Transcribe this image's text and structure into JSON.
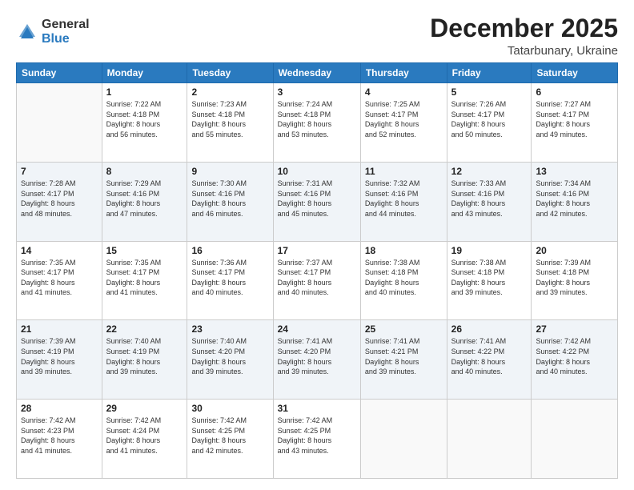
{
  "logo": {
    "general": "General",
    "blue": "Blue"
  },
  "title": "December 2025",
  "location": "Tatarbunary, Ukraine",
  "days_header": [
    "Sunday",
    "Monday",
    "Tuesday",
    "Wednesday",
    "Thursday",
    "Friday",
    "Saturday"
  ],
  "weeks": [
    [
      {
        "day": "",
        "info": ""
      },
      {
        "day": "1",
        "info": "Sunrise: 7:22 AM\nSunset: 4:18 PM\nDaylight: 8 hours\nand 56 minutes."
      },
      {
        "day": "2",
        "info": "Sunrise: 7:23 AM\nSunset: 4:18 PM\nDaylight: 8 hours\nand 55 minutes."
      },
      {
        "day": "3",
        "info": "Sunrise: 7:24 AM\nSunset: 4:18 PM\nDaylight: 8 hours\nand 53 minutes."
      },
      {
        "day": "4",
        "info": "Sunrise: 7:25 AM\nSunset: 4:17 PM\nDaylight: 8 hours\nand 52 minutes."
      },
      {
        "day": "5",
        "info": "Sunrise: 7:26 AM\nSunset: 4:17 PM\nDaylight: 8 hours\nand 50 minutes."
      },
      {
        "day": "6",
        "info": "Sunrise: 7:27 AM\nSunset: 4:17 PM\nDaylight: 8 hours\nand 49 minutes."
      }
    ],
    [
      {
        "day": "7",
        "info": "Sunrise: 7:28 AM\nSunset: 4:17 PM\nDaylight: 8 hours\nand 48 minutes."
      },
      {
        "day": "8",
        "info": "Sunrise: 7:29 AM\nSunset: 4:16 PM\nDaylight: 8 hours\nand 47 minutes."
      },
      {
        "day": "9",
        "info": "Sunrise: 7:30 AM\nSunset: 4:16 PM\nDaylight: 8 hours\nand 46 minutes."
      },
      {
        "day": "10",
        "info": "Sunrise: 7:31 AM\nSunset: 4:16 PM\nDaylight: 8 hours\nand 45 minutes."
      },
      {
        "day": "11",
        "info": "Sunrise: 7:32 AM\nSunset: 4:16 PM\nDaylight: 8 hours\nand 44 minutes."
      },
      {
        "day": "12",
        "info": "Sunrise: 7:33 AM\nSunset: 4:16 PM\nDaylight: 8 hours\nand 43 minutes."
      },
      {
        "day": "13",
        "info": "Sunrise: 7:34 AM\nSunset: 4:16 PM\nDaylight: 8 hours\nand 42 minutes."
      }
    ],
    [
      {
        "day": "14",
        "info": "Sunrise: 7:35 AM\nSunset: 4:17 PM\nDaylight: 8 hours\nand 41 minutes."
      },
      {
        "day": "15",
        "info": "Sunrise: 7:35 AM\nSunset: 4:17 PM\nDaylight: 8 hours\nand 41 minutes."
      },
      {
        "day": "16",
        "info": "Sunrise: 7:36 AM\nSunset: 4:17 PM\nDaylight: 8 hours\nand 40 minutes."
      },
      {
        "day": "17",
        "info": "Sunrise: 7:37 AM\nSunset: 4:17 PM\nDaylight: 8 hours\nand 40 minutes."
      },
      {
        "day": "18",
        "info": "Sunrise: 7:38 AM\nSunset: 4:18 PM\nDaylight: 8 hours\nand 40 minutes."
      },
      {
        "day": "19",
        "info": "Sunrise: 7:38 AM\nSunset: 4:18 PM\nDaylight: 8 hours\nand 39 minutes."
      },
      {
        "day": "20",
        "info": "Sunrise: 7:39 AM\nSunset: 4:18 PM\nDaylight: 8 hours\nand 39 minutes."
      }
    ],
    [
      {
        "day": "21",
        "info": "Sunrise: 7:39 AM\nSunset: 4:19 PM\nDaylight: 8 hours\nand 39 minutes."
      },
      {
        "day": "22",
        "info": "Sunrise: 7:40 AM\nSunset: 4:19 PM\nDaylight: 8 hours\nand 39 minutes."
      },
      {
        "day": "23",
        "info": "Sunrise: 7:40 AM\nSunset: 4:20 PM\nDaylight: 8 hours\nand 39 minutes."
      },
      {
        "day": "24",
        "info": "Sunrise: 7:41 AM\nSunset: 4:20 PM\nDaylight: 8 hours\nand 39 minutes."
      },
      {
        "day": "25",
        "info": "Sunrise: 7:41 AM\nSunset: 4:21 PM\nDaylight: 8 hours\nand 39 minutes."
      },
      {
        "day": "26",
        "info": "Sunrise: 7:41 AM\nSunset: 4:22 PM\nDaylight: 8 hours\nand 40 minutes."
      },
      {
        "day": "27",
        "info": "Sunrise: 7:42 AM\nSunset: 4:22 PM\nDaylight: 8 hours\nand 40 minutes."
      }
    ],
    [
      {
        "day": "28",
        "info": "Sunrise: 7:42 AM\nSunset: 4:23 PM\nDaylight: 8 hours\nand 41 minutes."
      },
      {
        "day": "29",
        "info": "Sunrise: 7:42 AM\nSunset: 4:24 PM\nDaylight: 8 hours\nand 41 minutes."
      },
      {
        "day": "30",
        "info": "Sunrise: 7:42 AM\nSunset: 4:25 PM\nDaylight: 8 hours\nand 42 minutes."
      },
      {
        "day": "31",
        "info": "Sunrise: 7:42 AM\nSunset: 4:25 PM\nDaylight: 8 hours\nand 43 minutes."
      },
      {
        "day": "",
        "info": ""
      },
      {
        "day": "",
        "info": ""
      },
      {
        "day": "",
        "info": ""
      }
    ]
  ]
}
